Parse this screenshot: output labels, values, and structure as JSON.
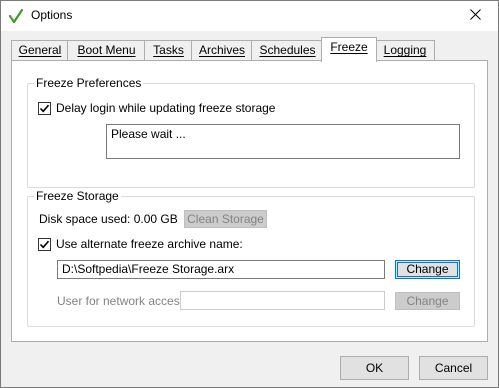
{
  "window": {
    "title": "Options",
    "close_glyph": "✕"
  },
  "tabs": [
    {
      "label": "General",
      "active": false
    },
    {
      "label": "Boot Menu",
      "active": false
    },
    {
      "label": "Tasks",
      "active": false
    },
    {
      "label": "Archives",
      "active": false
    },
    {
      "label": "Schedules",
      "active": false
    },
    {
      "label": "Freeze",
      "active": true
    },
    {
      "label": "Logging",
      "active": false
    }
  ],
  "freeze_preferences": {
    "title": "Freeze Preferences",
    "delay_login_label": "Delay login while updating freeze storage",
    "delay_login_checked": true,
    "status_text": "Please wait ..."
  },
  "freeze_storage": {
    "title": "Freeze Storage",
    "disk_space_label": "Disk space used: 0.00 GB",
    "clean_storage_label": "Clean Storage",
    "alt_archive_label": "Use alternate freeze archive name:",
    "alt_archive_checked": true,
    "archive_path": "D:\\Softpedia\\Freeze Storage.arx",
    "change_label": "Change",
    "network_user_label": "User for network access:",
    "network_user_value": "",
    "network_change_label": "Change"
  },
  "footer": {
    "ok_label": "OK",
    "cancel_label": "Cancel"
  },
  "colors": {
    "accent": "#0078d7",
    "app_icon": "#3a9a2a"
  }
}
